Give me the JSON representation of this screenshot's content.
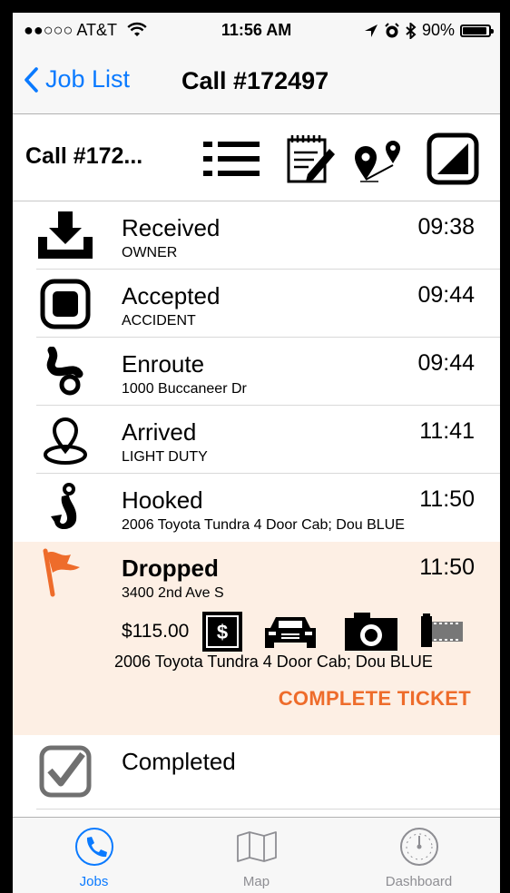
{
  "status_bar": {
    "carrier": "●●○○○ AT&T",
    "time": "11:56 AM",
    "battery": "90%"
  },
  "nav": {
    "back_label": "Job List",
    "title": "Call #172497"
  },
  "toolbar": {
    "title": "Call #172...",
    "icons": [
      "list-icon",
      "notepad-icon",
      "route-icon",
      "status-icon"
    ]
  },
  "timeline": [
    {
      "label": "Received",
      "sub": "OWNER",
      "time": "09:38",
      "icon": "download-icon"
    },
    {
      "label": "Accepted",
      "sub": "ACCIDENT",
      "time": "09:44",
      "icon": "stop-square-icon"
    },
    {
      "label": "Enroute",
      "sub": "1000 Buccaneer Dr",
      "time": "09:44",
      "icon": "winding-road-icon"
    },
    {
      "label": "Arrived",
      "sub": "LIGHT DUTY",
      "time": "11:41",
      "icon": "location-pin-icon"
    },
    {
      "label": "Hooked",
      "sub": "2006 Toyota Tundra 4 Door Cab; Dou BLUE",
      "time": "11:50",
      "icon": "hook-icon"
    }
  ],
  "active_step": {
    "label": "Dropped",
    "sub": "3400 2nd Ave S",
    "time": "11:50",
    "icon": "flag-icon",
    "price": "$115.00",
    "vehicle": "2006 Toyota Tundra 4 Door Cab; Dou BLUE",
    "action": "COMPLETE TICKET",
    "accent": "#ee6c2b",
    "background": "#fdefe4"
  },
  "completed_step": {
    "label": "Completed",
    "icon": "checkbox-icon"
  },
  "tabs": [
    {
      "label": "Jobs",
      "icon": "phone-icon",
      "selected": true
    },
    {
      "label": "Map",
      "icon": "map-icon",
      "selected": false
    },
    {
      "label": "Dashboard",
      "icon": "gauge-icon",
      "selected": false
    }
  ],
  "colors": {
    "ios_blue": "#0a7aff",
    "tab_gray": "#8e8e93"
  }
}
